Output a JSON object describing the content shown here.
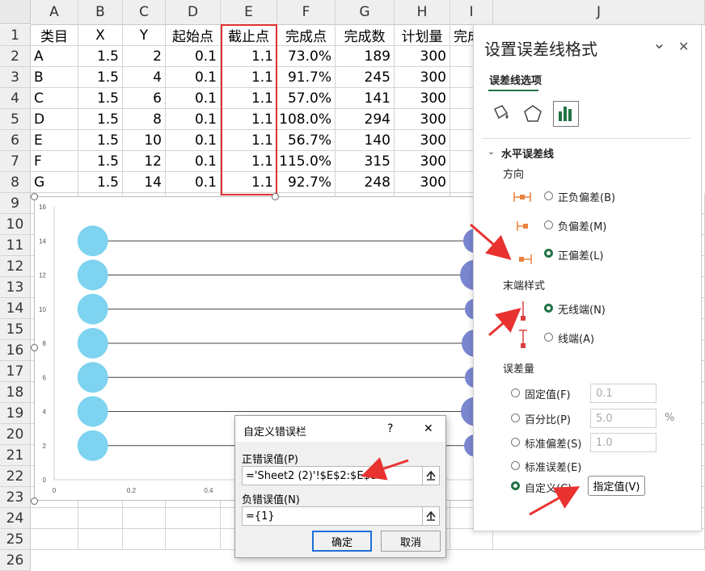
{
  "columns": [
    "A",
    "B",
    "C",
    "D",
    "E",
    "F",
    "G",
    "H",
    "I",
    "J"
  ],
  "rows": [
    "1",
    "2",
    "3",
    "4",
    "5",
    "6",
    "7",
    "8",
    "9",
    "10",
    "11",
    "12",
    "13",
    "14",
    "15",
    "16",
    "17",
    "18",
    "19",
    "20",
    "21",
    "22",
    "23",
    "24",
    "25",
    "26"
  ],
  "table": {
    "headers": [
      "类目",
      "X",
      "Y",
      "起始点",
      "截止点",
      "完成点",
      "完成数",
      "计划量",
      "完成"
    ],
    "data": [
      [
        "A",
        "1.5",
        "2",
        "0.1",
        "1.1",
        "73.0%",
        "189",
        "300"
      ],
      [
        "B",
        "1.5",
        "4",
        "0.1",
        "1.1",
        "91.7%",
        "245",
        "300"
      ],
      [
        "C",
        "1.5",
        "6",
        "0.1",
        "1.1",
        "57.0%",
        "141",
        "300"
      ],
      [
        "D",
        "1.5",
        "8",
        "0.1",
        "1.1",
        "108.0%",
        "294",
        "300"
      ],
      [
        "E",
        "1.5",
        "10",
        "0.1",
        "1.1",
        "56.7%",
        "140",
        "300"
      ],
      [
        "F",
        "1.5",
        "12",
        "0.1",
        "1.1",
        "115.0%",
        "315",
        "300",
        "1"
      ],
      [
        "G",
        "1.5",
        "14",
        "0.1",
        "1.1",
        "92.7%",
        "248",
        "300"
      ]
    ]
  },
  "chart_data": {
    "type": "scatter",
    "x_ticks": [
      "0",
      "0.2",
      "0.4",
      "0.6"
    ],
    "y_ticks": [
      "0",
      "2",
      "4",
      "6",
      "8",
      "10",
      "12",
      "14",
      "16"
    ],
    "xlim": [
      0,
      1.5
    ],
    "ylim": [
      0,
      16
    ],
    "series": [
      {
        "x": [
          0.1,
          0.1,
          0.1,
          0.1,
          0.1,
          0.1,
          0.1
        ],
        "y": [
          2,
          4,
          6,
          8,
          10,
          12,
          14
        ],
        "error_bar_end": 1.1,
        "color": "#7dd3f0"
      }
    ],
    "right_bubbles_y": [
      2,
      4,
      6,
      8,
      10,
      12,
      14
    ],
    "right_bubbles_color": "#7b86d1"
  },
  "pane": {
    "title": "设置误差线格式",
    "tab": "误差线选项",
    "section": "水平误差线",
    "direction_label": "方向",
    "dir_options": [
      "正负偏差(B)",
      "负偏差(M)",
      "正偏差(L)"
    ],
    "end_label": "末端样式",
    "end_options": [
      "无线端(N)",
      "线端(A)"
    ],
    "amount_label": "误差量",
    "amount_options": [
      "固定值(F)",
      "百分比(P)",
      "标准偏差(S)",
      "标准误差(E)",
      "自定义(C)"
    ],
    "fixed_value": "0.1",
    "percent_value": "5.0",
    "percent_unit": "%",
    "stddev_value": "1.0",
    "specify_button": "指定值(V)",
    "collapse_glyph": "⌄",
    "close_glyph": "✕"
  },
  "dialog": {
    "title": "自定义错误栏",
    "help": "?",
    "close": "✕",
    "pos_label": "正错误值(P)",
    "pos_value": "='Sheet2 (2)'!$E$2:$E$8",
    "neg_label": "负错误值(N)",
    "neg_value": "={1}",
    "ok": "确定",
    "cancel": "取消"
  },
  "colors": {
    "accent": "#217346",
    "highlight_red": "#e03030",
    "arrow_red": "#e8322f"
  }
}
